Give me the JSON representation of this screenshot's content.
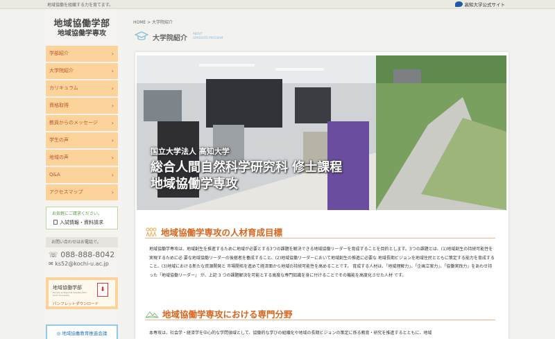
{
  "topbar": {
    "tagline": "地域協働を組織する力を育てます。",
    "official": "高知大学公式サイト"
  },
  "site": {
    "title": "地域協働学部",
    "subtitle": "地域協働学専攻"
  },
  "nav": [
    {
      "label": "学部紹介"
    },
    {
      "label": "大学院紹介"
    },
    {
      "label": "カリキュラム"
    },
    {
      "label": "資格取得"
    },
    {
      "label": "教員からのメッセージ"
    },
    {
      "label": "学生の声"
    },
    {
      "label": "地域の声"
    },
    {
      "label": "Q&A"
    },
    {
      "label": "アクセスマップ"
    }
  ],
  "request": {
    "small": "お気軽にご請求ください。",
    "big": "入試情報・資料請求"
  },
  "contact": {
    "heading": "お問い合わせはお電話で。",
    "tel": "088-888-8042",
    "mail": "ks52@kochi-u.ac.jp"
  },
  "pamphlet": {
    "name": "地域協働学部",
    "sub": "Faculty of Regional Collaboration Kochi University",
    "download": "パンフレットダウンロード"
  },
  "council": {
    "label": "◎ 地域協働教育推進会議"
  },
  "breadcrumb": "HOME > 大学院紹介",
  "page": {
    "title": "大学院紹介",
    "en_line1": "ABOUT",
    "en_line2": "GRADUATE PROGRAM"
  },
  "hero": {
    "line1": "国立大学法人 高知大学",
    "line2": "総合人間自然科学研究科 修士課程",
    "line3": "地域協働学専攻"
  },
  "section1": {
    "title": "地域協働学専攻の人材育成目標",
    "body": "地域協働学専攻は、地域創生を推進するために地域が必要とする3つの課題を解決できる地域協働リーダーを育成することを目的とします。3つの課題とは、(1)地域創生の持続可能性を実現するために必 要な地域協働リーダーの後継者を養成すること、(2)地域協働リーダーにおいて地域創生の推進に必要な 地域長期ビジョンを地域住民とともに策定する能力を育成すること、(3)地域における新たな資源開発と 市場開拓を進めて経済面から地域の持続可能性を高めることです。 育成する人材は、「地域理解力」、「企画立案力」、「協働実践力」をあわせ持った「地域協働リーダー」 が、上記 3 つの課題解決を可能とする高度な専門知識を身に付けることでその機能を高度化させた人材 です。"
  },
  "section2": {
    "title": "地域協働学専攻における専門分野",
    "body": "本専攻は、社会学・経済学を中心的な学問領域として、協働的な学びの組織化や地域の長期ビジョンの策定に係る教育・研究を推進するとともに、地域"
  },
  "colors": {
    "accent": "#d7651e",
    "nav_bg": "#fbd39b",
    "nav_text": "#c0562a",
    "link_blue": "#2a77b0"
  }
}
